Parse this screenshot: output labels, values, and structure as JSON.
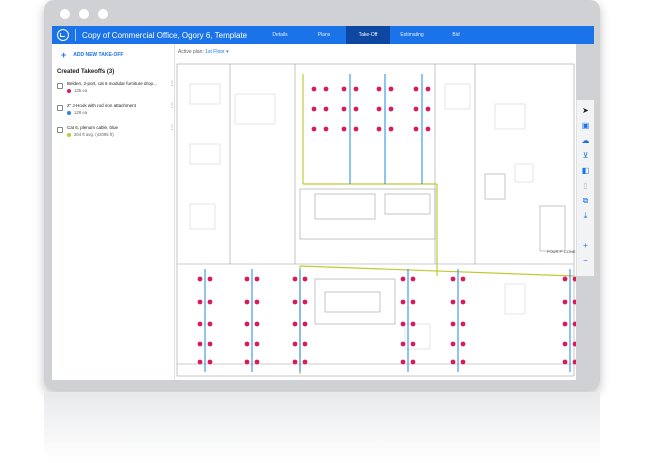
{
  "app": {
    "title": "Copy of Commercial Office, Ogory 6, Template",
    "tabs": [
      {
        "label": "Details",
        "active": false
      },
      {
        "label": "Plans",
        "active": false
      },
      {
        "label": "Take-Off",
        "active": true
      },
      {
        "label": "Estimating",
        "active": false
      },
      {
        "label": "Bid",
        "active": false
      }
    ],
    "accent_color": "#1a73e8"
  },
  "sidebar": {
    "add_label": "ADD NEW TAKE-OFF",
    "heading": "Created Takeoffs (3)",
    "takeoffs": [
      {
        "title": "Belden, 2-port, cat 6 modular furniture drop...",
        "qty": "135 ea",
        "color": "#d81b60"
      },
      {
        "title": "2\" J-Hook with rod iron attachment",
        "qty": "128 ea",
        "color": "#1e88e5"
      },
      {
        "title": "Cat 6, plenum cable, blue",
        "qty": "204 ft avg. (42095 ft)",
        "color": "#c0ca33"
      }
    ]
  },
  "canvas": {
    "active_plan_label": "Active plan:",
    "active_plan_value": "1st Floor",
    "room_label": "FOUR P' CONE"
  },
  "toolbar": {
    "tools": [
      "pointer-icon",
      "select-box-icon",
      "cloud-icon",
      "measure-icon",
      "layers-icon",
      "copy-icon",
      "stack-icon",
      "download-icon",
      "zoom-in-icon",
      "zoom-out-icon"
    ]
  }
}
